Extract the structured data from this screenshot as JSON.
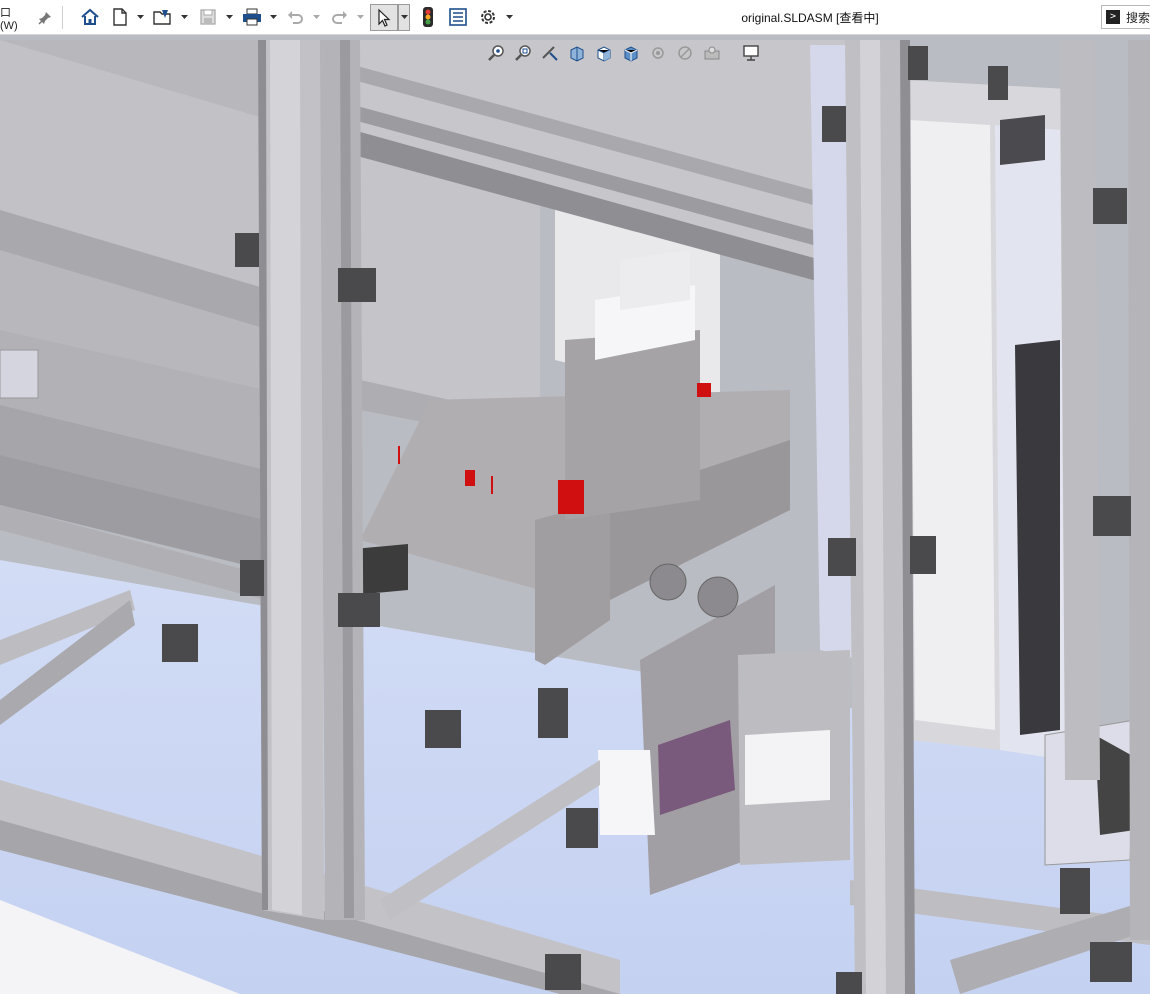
{
  "titlebar": {
    "menu_fragment": "口(W)",
    "document_title": "original.SLDASM [查看中]",
    "search_label": "搜索"
  },
  "toolbar": {
    "buttons": [
      {
        "name": "home-icon"
      },
      {
        "name": "new-document-icon"
      },
      {
        "name": "open-icon"
      },
      {
        "name": "save-icon"
      },
      {
        "name": "print-icon"
      },
      {
        "name": "undo-icon"
      },
      {
        "name": "redo-icon"
      },
      {
        "name": "select-arrow-icon"
      },
      {
        "name": "traffic-light-icon"
      },
      {
        "name": "file-properties-icon"
      },
      {
        "name": "options-gear-icon"
      }
    ]
  },
  "heads_up_toolbar": {
    "buttons": [
      {
        "name": "zoom-to-fit-icon"
      },
      {
        "name": "zoom-to-area-icon"
      },
      {
        "name": "previous-view-icon"
      },
      {
        "name": "section-view-icon"
      },
      {
        "name": "view-orientation-icon"
      },
      {
        "name": "display-style-icon"
      },
      {
        "name": "hide-show-items-icon"
      },
      {
        "name": "appearance-icon"
      },
      {
        "name": "scene-icon"
      },
      {
        "name": "view-settings-icon"
      }
    ]
  },
  "colors": {
    "floor": "#c8d5f3",
    "frame": "#bcbcbe",
    "frame_dark": "#8e8e92",
    "part_gray": "#9a9699",
    "part_white": "#f2f2f4",
    "accent_red": "#d01010",
    "bracket_dark": "#3c3c3c"
  }
}
